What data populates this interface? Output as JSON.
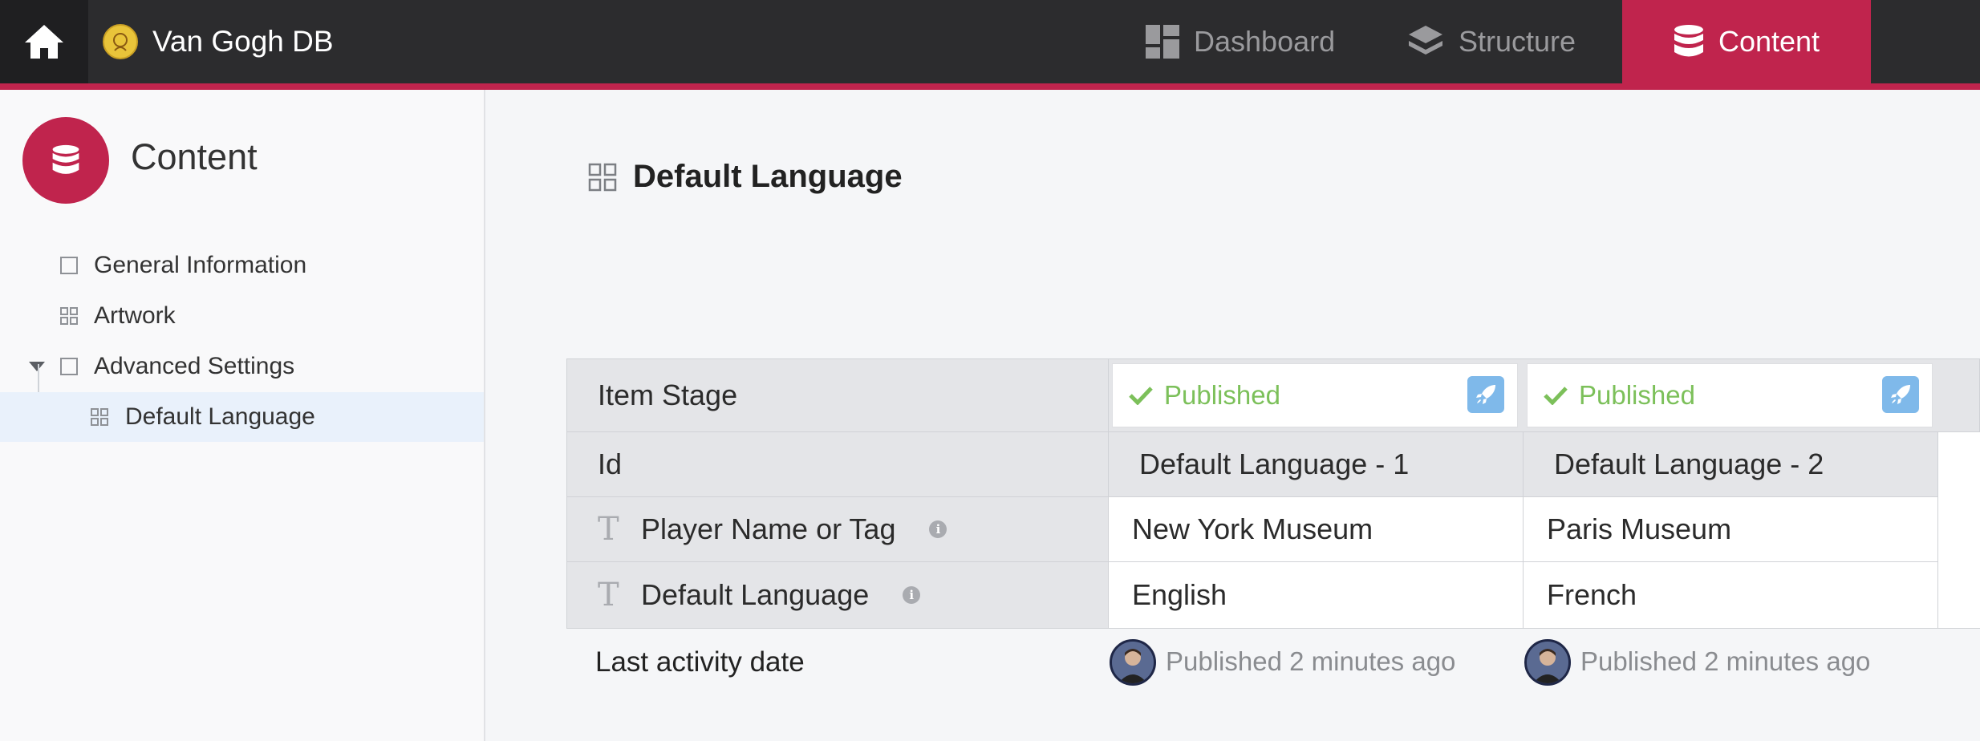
{
  "topbar": {
    "site_name": "Van Gogh DB",
    "nav": [
      {
        "label": "Dashboard",
        "icon": "dashboard-icon"
      },
      {
        "label": "Structure",
        "icon": "layers-icon"
      },
      {
        "label": "Content",
        "icon": "database-icon",
        "active": true
      }
    ]
  },
  "sidebar": {
    "title": "Content",
    "items": [
      {
        "label": "General Information",
        "icon": "square-icon"
      },
      {
        "label": "Artwork",
        "icon": "grid-icon"
      },
      {
        "label": "Advanced Settings",
        "icon": "square-icon",
        "expanded": true
      },
      {
        "label": "Default Language",
        "icon": "grid-icon",
        "active": true
      }
    ]
  },
  "main": {
    "title": "Default Language",
    "table": {
      "row_labels": {
        "stage": "Item Stage",
        "id": "Id",
        "field1": "Player Name or Tag",
        "field2": "Default Language",
        "activity": "Last activity date"
      },
      "records": [
        {
          "stage": "Published",
          "id": "Default Language - 1",
          "field1": "New York Museum",
          "field2": "English",
          "activity": "Published 2 minutes ago"
        },
        {
          "stage": "Published",
          "id": "Default Language - 2",
          "field1": "Paris Museum",
          "field2": "French",
          "activity": "Published 2 minutes ago"
        }
      ]
    }
  },
  "colors": {
    "accent": "#c0244d",
    "topbar": "#2c2c2e",
    "published": "#7cc05a",
    "rocket": "#7fb9ea"
  }
}
